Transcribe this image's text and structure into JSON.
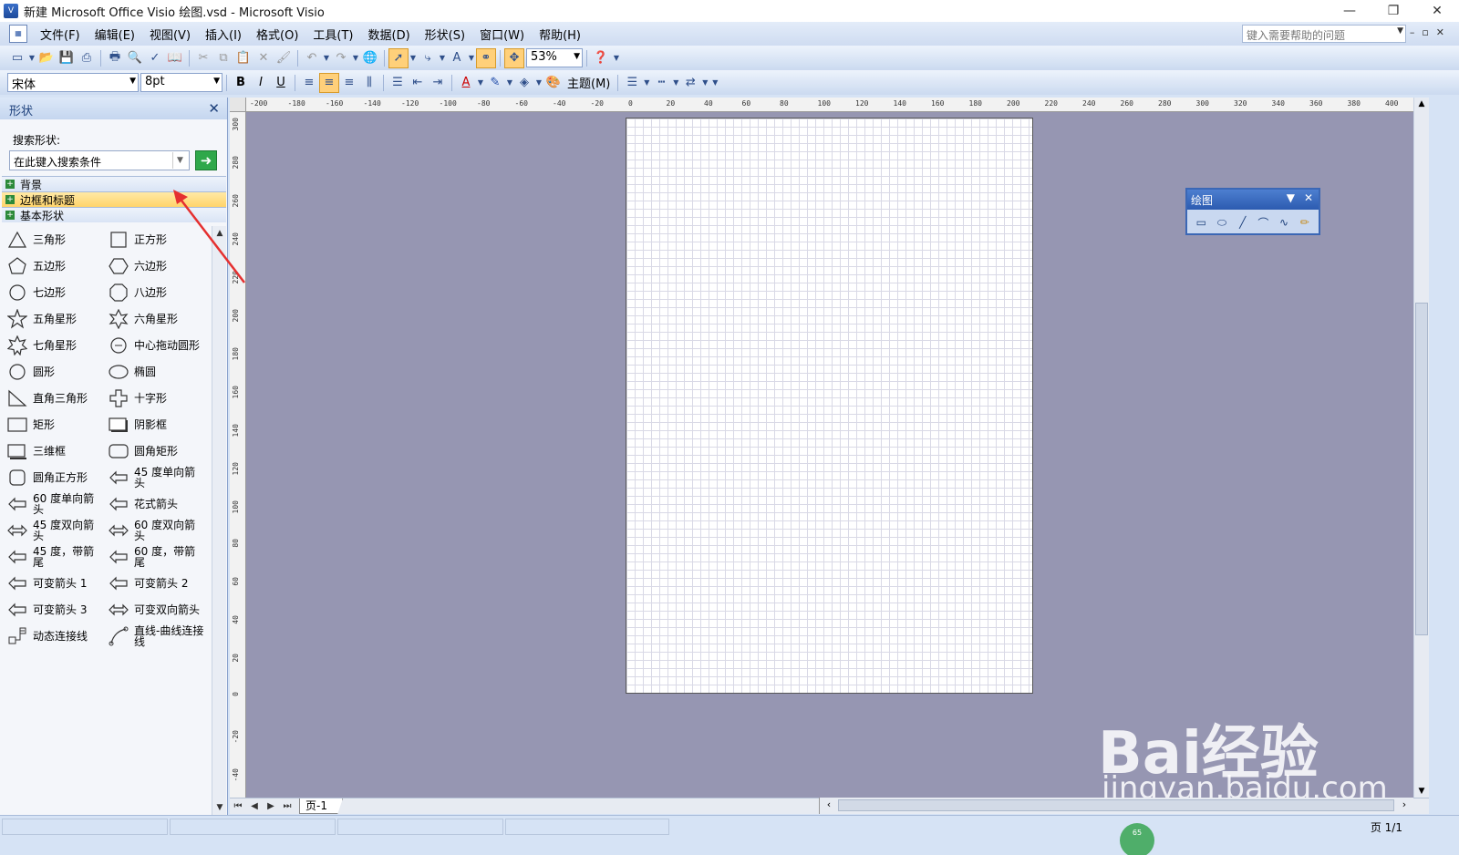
{
  "window": {
    "title": "新建 Microsoft Office Visio 绘图.vsd - Microsoft Visio",
    "minimize": "—",
    "restore": "❐",
    "close": "✕"
  },
  "menubar": {
    "items": [
      "文件(F)",
      "编辑(E)",
      "视图(V)",
      "插入(I)",
      "格式(O)",
      "工具(T)",
      "数据(D)",
      "形状(S)",
      "窗口(W)",
      "帮助(H)"
    ],
    "help_placeholder": "键入需要帮助的问题"
  },
  "toolbar_standard": {
    "zoom": "53%"
  },
  "toolbar_format": {
    "font": "宋体",
    "size": "8pt",
    "bold": "B",
    "italic": "I",
    "underline": "U",
    "theme_label": "主题(M)"
  },
  "shapes_panel": {
    "title": "形状",
    "search_label": "搜索形状:",
    "search_placeholder": "在此键入搜索条件",
    "stencils": [
      "背景",
      "边框和标题",
      "基本形状"
    ],
    "active_stencil": "边框和标题",
    "items": [
      {
        "label": "三角形",
        "icon": "triangle-icon"
      },
      {
        "label": "正方形",
        "icon": "square-icon"
      },
      {
        "label": "五边形",
        "icon": "pentagon-icon"
      },
      {
        "label": "六边形",
        "icon": "hexagon-icon"
      },
      {
        "label": "七边形",
        "icon": "heptagon-icon"
      },
      {
        "label": "八边形",
        "icon": "octagon-icon"
      },
      {
        "label": "五角星形",
        "icon": "star5-icon"
      },
      {
        "label": "六角星形",
        "icon": "star6-icon"
      },
      {
        "label": "七角星形",
        "icon": "star7-icon"
      },
      {
        "label": "中心拖动圆形",
        "icon": "center-circle-icon"
      },
      {
        "label": "圆形",
        "icon": "circle-icon"
      },
      {
        "label": "椭圆",
        "icon": "ellipse-icon"
      },
      {
        "label": "直角三角形",
        "icon": "right-triangle-icon"
      },
      {
        "label": "十字形",
        "icon": "cross-icon"
      },
      {
        "label": "矩形",
        "icon": "rectangle-icon"
      },
      {
        "label": "阴影框",
        "icon": "shadow-box-icon"
      },
      {
        "label": "三维框",
        "icon": "3d-box-icon"
      },
      {
        "label": "圆角矩形",
        "icon": "rounded-rectangle-icon"
      },
      {
        "label": "圆角正方形",
        "icon": "rounded-square-icon"
      },
      {
        "label": "45 度单向箭头",
        "icon": "arrow-45-single-icon"
      },
      {
        "label": "60 度单向箭头",
        "icon": "arrow-60-single-icon"
      },
      {
        "label": "花式箭头",
        "icon": "fancy-arrow-icon"
      },
      {
        "label": "45 度双向箭头",
        "icon": "arrow-45-double-icon"
      },
      {
        "label": "60 度双向箭头",
        "icon": "arrow-60-double-icon"
      },
      {
        "label": "45 度，带箭尾",
        "icon": "arrow-45-tail-icon"
      },
      {
        "label": "60 度，带箭尾",
        "icon": "arrow-60-tail-icon"
      },
      {
        "label": "可变箭头 1",
        "icon": "variable-arrow-1-icon"
      },
      {
        "label": "可变箭头 2",
        "icon": "variable-arrow-2-icon"
      },
      {
        "label": "可变箭头 3",
        "icon": "variable-arrow-3-icon"
      },
      {
        "label": "可变双向箭头",
        "icon": "variable-double-arrow-icon"
      },
      {
        "label": "动态连接线",
        "icon": "dynamic-connector-icon"
      },
      {
        "label": "直线-曲线连接线",
        "icon": "line-curve-connector-icon"
      }
    ]
  },
  "rulers": {
    "horizontal": [
      "-200",
      "-180",
      "-160",
      "-140",
      "-120",
      "-100",
      "-80",
      "-60",
      "-40",
      "-20",
      "0",
      "20",
      "40",
      "60",
      "80",
      "100",
      "120",
      "140",
      "160",
      "180",
      "200",
      "220",
      "240",
      "260",
      "280",
      "300",
      "320",
      "340",
      "360",
      "380",
      "400"
    ],
    "vertical": [
      "300",
      "280",
      "260",
      "240",
      "220",
      "200",
      "180",
      "160",
      "140",
      "120",
      "100",
      "80",
      "60",
      "40",
      "20",
      "0",
      "-20",
      "-40"
    ]
  },
  "drawing_toolbar": {
    "title": "绘图",
    "tools": [
      "rectangle-tool-icon",
      "ellipse-tool-icon",
      "line-tool-icon",
      "arc-tool-icon",
      "freeform-tool-icon",
      "pencil-tool-icon"
    ]
  },
  "page_tabs": {
    "current": "页-1"
  },
  "statusbar": {
    "page_info": "页 1/1",
    "indicator": "65"
  },
  "watermark": {
    "brand": "Bai经验",
    "url": "jingyan.baidu.com"
  },
  "colors": {
    "canvas_bg": "#9696b2",
    "accent": "#2c5bb0",
    "active_stencil": "#ffd46a",
    "annotation_arrow": "#e53030"
  }
}
